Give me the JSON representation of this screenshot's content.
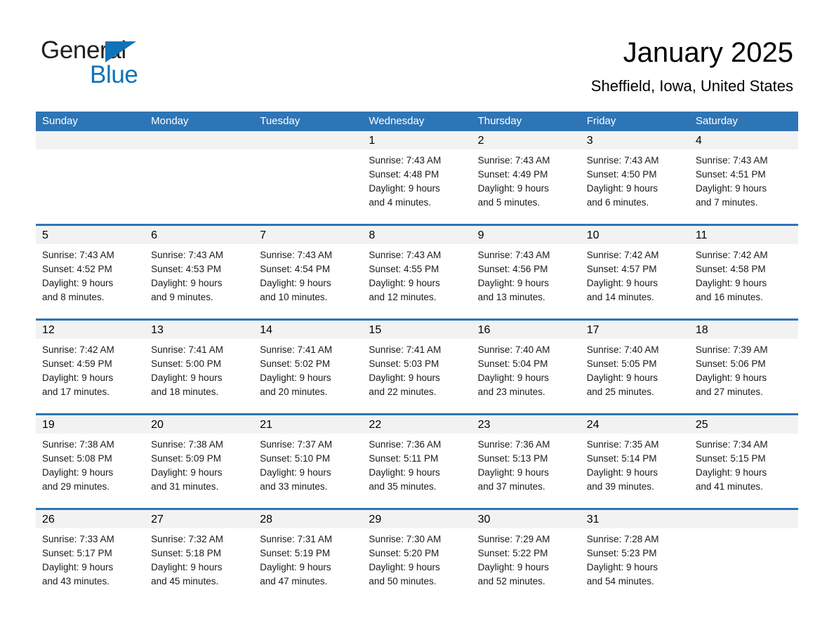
{
  "brand": {
    "name_part1": "General",
    "name_part2": "Blue",
    "triangle_color": "#1073b8",
    "text_color": "#231f20"
  },
  "header": {
    "title": "January 2025",
    "subtitle": "Sheffield, Iowa, United States"
  },
  "theme": {
    "header_blue": "#2e75b6",
    "day_band_gray": "#f2f2f2",
    "page_background": "#ffffff",
    "text_color": "#000000"
  },
  "weekdays": [
    "Sunday",
    "Monday",
    "Tuesday",
    "Wednesday",
    "Thursday",
    "Friday",
    "Saturday"
  ],
  "weeks": [
    [
      {
        "day": "",
        "sunrise": "",
        "sunset": "",
        "daylight_line1": "",
        "daylight_line2": "",
        "empty": true
      },
      {
        "day": "",
        "sunrise": "",
        "sunset": "",
        "daylight_line1": "",
        "daylight_line2": "",
        "empty": true
      },
      {
        "day": "",
        "sunrise": "",
        "sunset": "",
        "daylight_line1": "",
        "daylight_line2": "",
        "empty": true
      },
      {
        "day": "1",
        "sunrise": "Sunrise: 7:43 AM",
        "sunset": "Sunset: 4:48 PM",
        "daylight_line1": "Daylight: 9 hours",
        "daylight_line2": "and 4 minutes.",
        "empty": false
      },
      {
        "day": "2",
        "sunrise": "Sunrise: 7:43 AM",
        "sunset": "Sunset: 4:49 PM",
        "daylight_line1": "Daylight: 9 hours",
        "daylight_line2": "and 5 minutes.",
        "empty": false
      },
      {
        "day": "3",
        "sunrise": "Sunrise: 7:43 AM",
        "sunset": "Sunset: 4:50 PM",
        "daylight_line1": "Daylight: 9 hours",
        "daylight_line2": "and 6 minutes.",
        "empty": false
      },
      {
        "day": "4",
        "sunrise": "Sunrise: 7:43 AM",
        "sunset": "Sunset: 4:51 PM",
        "daylight_line1": "Daylight: 9 hours",
        "daylight_line2": "and 7 minutes.",
        "empty": false
      }
    ],
    [
      {
        "day": "5",
        "sunrise": "Sunrise: 7:43 AM",
        "sunset": "Sunset: 4:52 PM",
        "daylight_line1": "Daylight: 9 hours",
        "daylight_line2": "and 8 minutes.",
        "empty": false
      },
      {
        "day": "6",
        "sunrise": "Sunrise: 7:43 AM",
        "sunset": "Sunset: 4:53 PM",
        "daylight_line1": "Daylight: 9 hours",
        "daylight_line2": "and 9 minutes.",
        "empty": false
      },
      {
        "day": "7",
        "sunrise": "Sunrise: 7:43 AM",
        "sunset": "Sunset: 4:54 PM",
        "daylight_line1": "Daylight: 9 hours",
        "daylight_line2": "and 10 minutes.",
        "empty": false
      },
      {
        "day": "8",
        "sunrise": "Sunrise: 7:43 AM",
        "sunset": "Sunset: 4:55 PM",
        "daylight_line1": "Daylight: 9 hours",
        "daylight_line2": "and 12 minutes.",
        "empty": false
      },
      {
        "day": "9",
        "sunrise": "Sunrise: 7:43 AM",
        "sunset": "Sunset: 4:56 PM",
        "daylight_line1": "Daylight: 9 hours",
        "daylight_line2": "and 13 minutes.",
        "empty": false
      },
      {
        "day": "10",
        "sunrise": "Sunrise: 7:42 AM",
        "sunset": "Sunset: 4:57 PM",
        "daylight_line1": "Daylight: 9 hours",
        "daylight_line2": "and 14 minutes.",
        "empty": false
      },
      {
        "day": "11",
        "sunrise": "Sunrise: 7:42 AM",
        "sunset": "Sunset: 4:58 PM",
        "daylight_line1": "Daylight: 9 hours",
        "daylight_line2": "and 16 minutes.",
        "empty": false
      }
    ],
    [
      {
        "day": "12",
        "sunrise": "Sunrise: 7:42 AM",
        "sunset": "Sunset: 4:59 PM",
        "daylight_line1": "Daylight: 9 hours",
        "daylight_line2": "and 17 minutes.",
        "empty": false
      },
      {
        "day": "13",
        "sunrise": "Sunrise: 7:41 AM",
        "sunset": "Sunset: 5:00 PM",
        "daylight_line1": "Daylight: 9 hours",
        "daylight_line2": "and 18 minutes.",
        "empty": false
      },
      {
        "day": "14",
        "sunrise": "Sunrise: 7:41 AM",
        "sunset": "Sunset: 5:02 PM",
        "daylight_line1": "Daylight: 9 hours",
        "daylight_line2": "and 20 minutes.",
        "empty": false
      },
      {
        "day": "15",
        "sunrise": "Sunrise: 7:41 AM",
        "sunset": "Sunset: 5:03 PM",
        "daylight_line1": "Daylight: 9 hours",
        "daylight_line2": "and 22 minutes.",
        "empty": false
      },
      {
        "day": "16",
        "sunrise": "Sunrise: 7:40 AM",
        "sunset": "Sunset: 5:04 PM",
        "daylight_line1": "Daylight: 9 hours",
        "daylight_line2": "and 23 minutes.",
        "empty": false
      },
      {
        "day": "17",
        "sunrise": "Sunrise: 7:40 AM",
        "sunset": "Sunset: 5:05 PM",
        "daylight_line1": "Daylight: 9 hours",
        "daylight_line2": "and 25 minutes.",
        "empty": false
      },
      {
        "day": "18",
        "sunrise": "Sunrise: 7:39 AM",
        "sunset": "Sunset: 5:06 PM",
        "daylight_line1": "Daylight: 9 hours",
        "daylight_line2": "and 27 minutes.",
        "empty": false
      }
    ],
    [
      {
        "day": "19",
        "sunrise": "Sunrise: 7:38 AM",
        "sunset": "Sunset: 5:08 PM",
        "daylight_line1": "Daylight: 9 hours",
        "daylight_line2": "and 29 minutes.",
        "empty": false
      },
      {
        "day": "20",
        "sunrise": "Sunrise: 7:38 AM",
        "sunset": "Sunset: 5:09 PM",
        "daylight_line1": "Daylight: 9 hours",
        "daylight_line2": "and 31 minutes.",
        "empty": false
      },
      {
        "day": "21",
        "sunrise": "Sunrise: 7:37 AM",
        "sunset": "Sunset: 5:10 PM",
        "daylight_line1": "Daylight: 9 hours",
        "daylight_line2": "and 33 minutes.",
        "empty": false
      },
      {
        "day": "22",
        "sunrise": "Sunrise: 7:36 AM",
        "sunset": "Sunset: 5:11 PM",
        "daylight_line1": "Daylight: 9 hours",
        "daylight_line2": "and 35 minutes.",
        "empty": false
      },
      {
        "day": "23",
        "sunrise": "Sunrise: 7:36 AM",
        "sunset": "Sunset: 5:13 PM",
        "daylight_line1": "Daylight: 9 hours",
        "daylight_line2": "and 37 minutes.",
        "empty": false
      },
      {
        "day": "24",
        "sunrise": "Sunrise: 7:35 AM",
        "sunset": "Sunset: 5:14 PM",
        "daylight_line1": "Daylight: 9 hours",
        "daylight_line2": "and 39 minutes.",
        "empty": false
      },
      {
        "day": "25",
        "sunrise": "Sunrise: 7:34 AM",
        "sunset": "Sunset: 5:15 PM",
        "daylight_line1": "Daylight: 9 hours",
        "daylight_line2": "and 41 minutes.",
        "empty": false
      }
    ],
    [
      {
        "day": "26",
        "sunrise": "Sunrise: 7:33 AM",
        "sunset": "Sunset: 5:17 PM",
        "daylight_line1": "Daylight: 9 hours",
        "daylight_line2": "and 43 minutes.",
        "empty": false
      },
      {
        "day": "27",
        "sunrise": "Sunrise: 7:32 AM",
        "sunset": "Sunset: 5:18 PM",
        "daylight_line1": "Daylight: 9 hours",
        "daylight_line2": "and 45 minutes.",
        "empty": false
      },
      {
        "day": "28",
        "sunrise": "Sunrise: 7:31 AM",
        "sunset": "Sunset: 5:19 PM",
        "daylight_line1": "Daylight: 9 hours",
        "daylight_line2": "and 47 minutes.",
        "empty": false
      },
      {
        "day": "29",
        "sunrise": "Sunrise: 7:30 AM",
        "sunset": "Sunset: 5:20 PM",
        "daylight_line1": "Daylight: 9 hours",
        "daylight_line2": "and 50 minutes.",
        "empty": false
      },
      {
        "day": "30",
        "sunrise": "Sunrise: 7:29 AM",
        "sunset": "Sunset: 5:22 PM",
        "daylight_line1": "Daylight: 9 hours",
        "daylight_line2": "and 52 minutes.",
        "empty": false
      },
      {
        "day": "31",
        "sunrise": "Sunrise: 7:28 AM",
        "sunset": "Sunset: 5:23 PM",
        "daylight_line1": "Daylight: 9 hours",
        "daylight_line2": "and 54 minutes.",
        "empty": false
      },
      {
        "day": "",
        "sunrise": "",
        "sunset": "",
        "daylight_line1": "",
        "daylight_line2": "",
        "empty": true
      }
    ]
  ]
}
